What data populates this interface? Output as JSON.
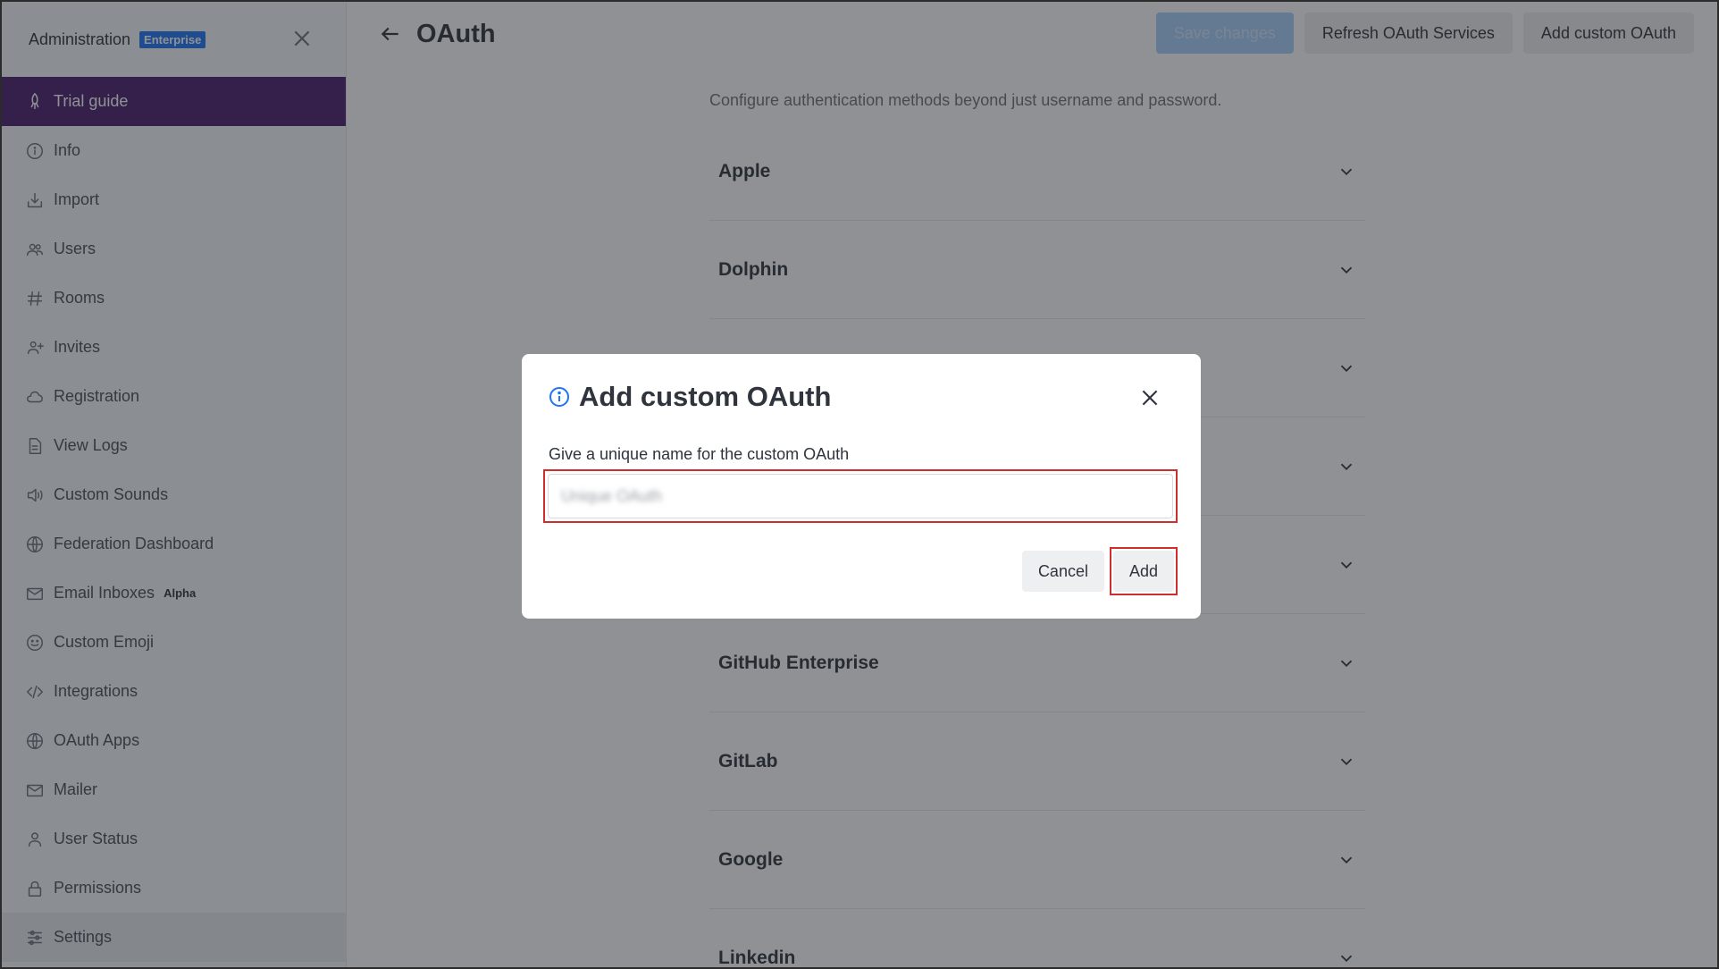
{
  "sidebar": {
    "title": "Administration",
    "badge": "Enterprise",
    "items": [
      {
        "label": "Trial guide",
        "icon": "rocket-icon"
      },
      {
        "label": "Info",
        "icon": "info-icon"
      },
      {
        "label": "Import",
        "icon": "import-icon"
      },
      {
        "label": "Users",
        "icon": "users-icon"
      },
      {
        "label": "Rooms",
        "icon": "hash-icon"
      },
      {
        "label": "Invites",
        "icon": "user-plus-icon"
      },
      {
        "label": "Registration",
        "icon": "cloud-icon"
      },
      {
        "label": "View Logs",
        "icon": "document-icon"
      },
      {
        "label": "Custom Sounds",
        "icon": "speaker-icon"
      },
      {
        "label": "Federation Dashboard",
        "icon": "globe-icon"
      },
      {
        "label": "Email Inboxes",
        "icon": "mail-icon",
        "tag": "Alpha"
      },
      {
        "label": "Custom Emoji",
        "icon": "emoji-icon"
      },
      {
        "label": "Integrations",
        "icon": "code-icon"
      },
      {
        "label": "OAuth Apps",
        "icon": "globe-icon"
      },
      {
        "label": "Mailer",
        "icon": "mail-icon"
      },
      {
        "label": "User Status",
        "icon": "user-icon"
      },
      {
        "label": "Permissions",
        "icon": "lock-icon"
      },
      {
        "label": "Settings",
        "icon": "sliders-icon"
      }
    ]
  },
  "header": {
    "title": "OAuth",
    "save_label": "Save changes",
    "refresh_label": "Refresh OAuth Services",
    "add_custom_label": "Add custom OAuth"
  },
  "main": {
    "description": "Configure authentication methods beyond just username and password.",
    "providers": [
      "Apple",
      "Dolphin",
      "",
      "",
      "",
      "GitHub Enterprise",
      "GitLab",
      "Google",
      "Linkedin"
    ]
  },
  "modal": {
    "title": "Add custom OAuth",
    "field_label": "Give a unique name for the custom OAuth",
    "field_placeholder": "Unique OAuth",
    "cancel_label": "Cancel",
    "add_label": "Add"
  },
  "colors": {
    "sidebar_active": "#4b1d6e",
    "accent_blue": "#1d74f5",
    "highlight_red": "#cf2e2e"
  }
}
